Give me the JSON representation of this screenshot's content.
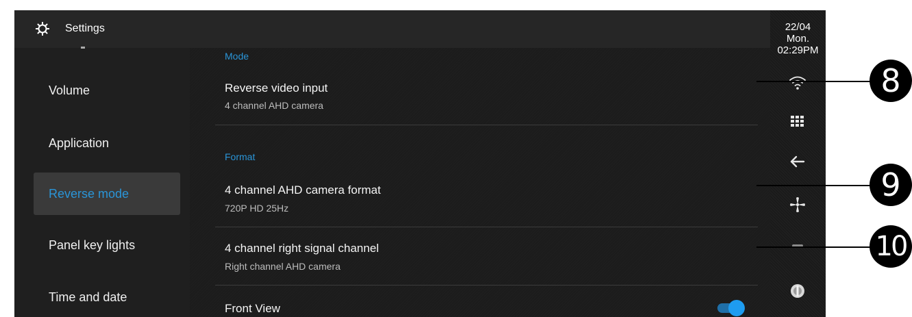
{
  "header": {
    "title": "Settings",
    "icon": "gear-icon"
  },
  "sidebar": {
    "items": [
      {
        "label": "Volume",
        "active": false
      },
      {
        "label": "Application",
        "active": false
      },
      {
        "label": "Reverse mode",
        "active": true
      },
      {
        "label": "Panel key lights",
        "active": false
      },
      {
        "label": "Time and date",
        "active": false
      }
    ]
  },
  "content": {
    "sections": [
      {
        "label": "Mode"
      },
      {
        "label": "Format"
      }
    ],
    "rows": [
      {
        "title": "Reverse video input",
        "subtitle": "4 channel AHD camera"
      },
      {
        "title": "4 channel AHD camera format",
        "subtitle": "720P HD 25Hz"
      },
      {
        "title": "4 channel right signal channel",
        "subtitle": "Right channel AHD camera"
      },
      {
        "title": "Front View",
        "toggle": true
      }
    ]
  },
  "status": {
    "date": "22/04",
    "day": "Mon.",
    "time": "02:29PM"
  },
  "right_icons": [
    "wifi-icon",
    "apps-grid-icon",
    "back-arrow-icon",
    "fan-icon",
    "steering-icon"
  ],
  "callouts": [
    "8",
    "9",
    "10"
  ],
  "colors": {
    "accent": "#2a95d8",
    "background": "#1c1c1c",
    "toggle_on": "#1e9cf0"
  }
}
